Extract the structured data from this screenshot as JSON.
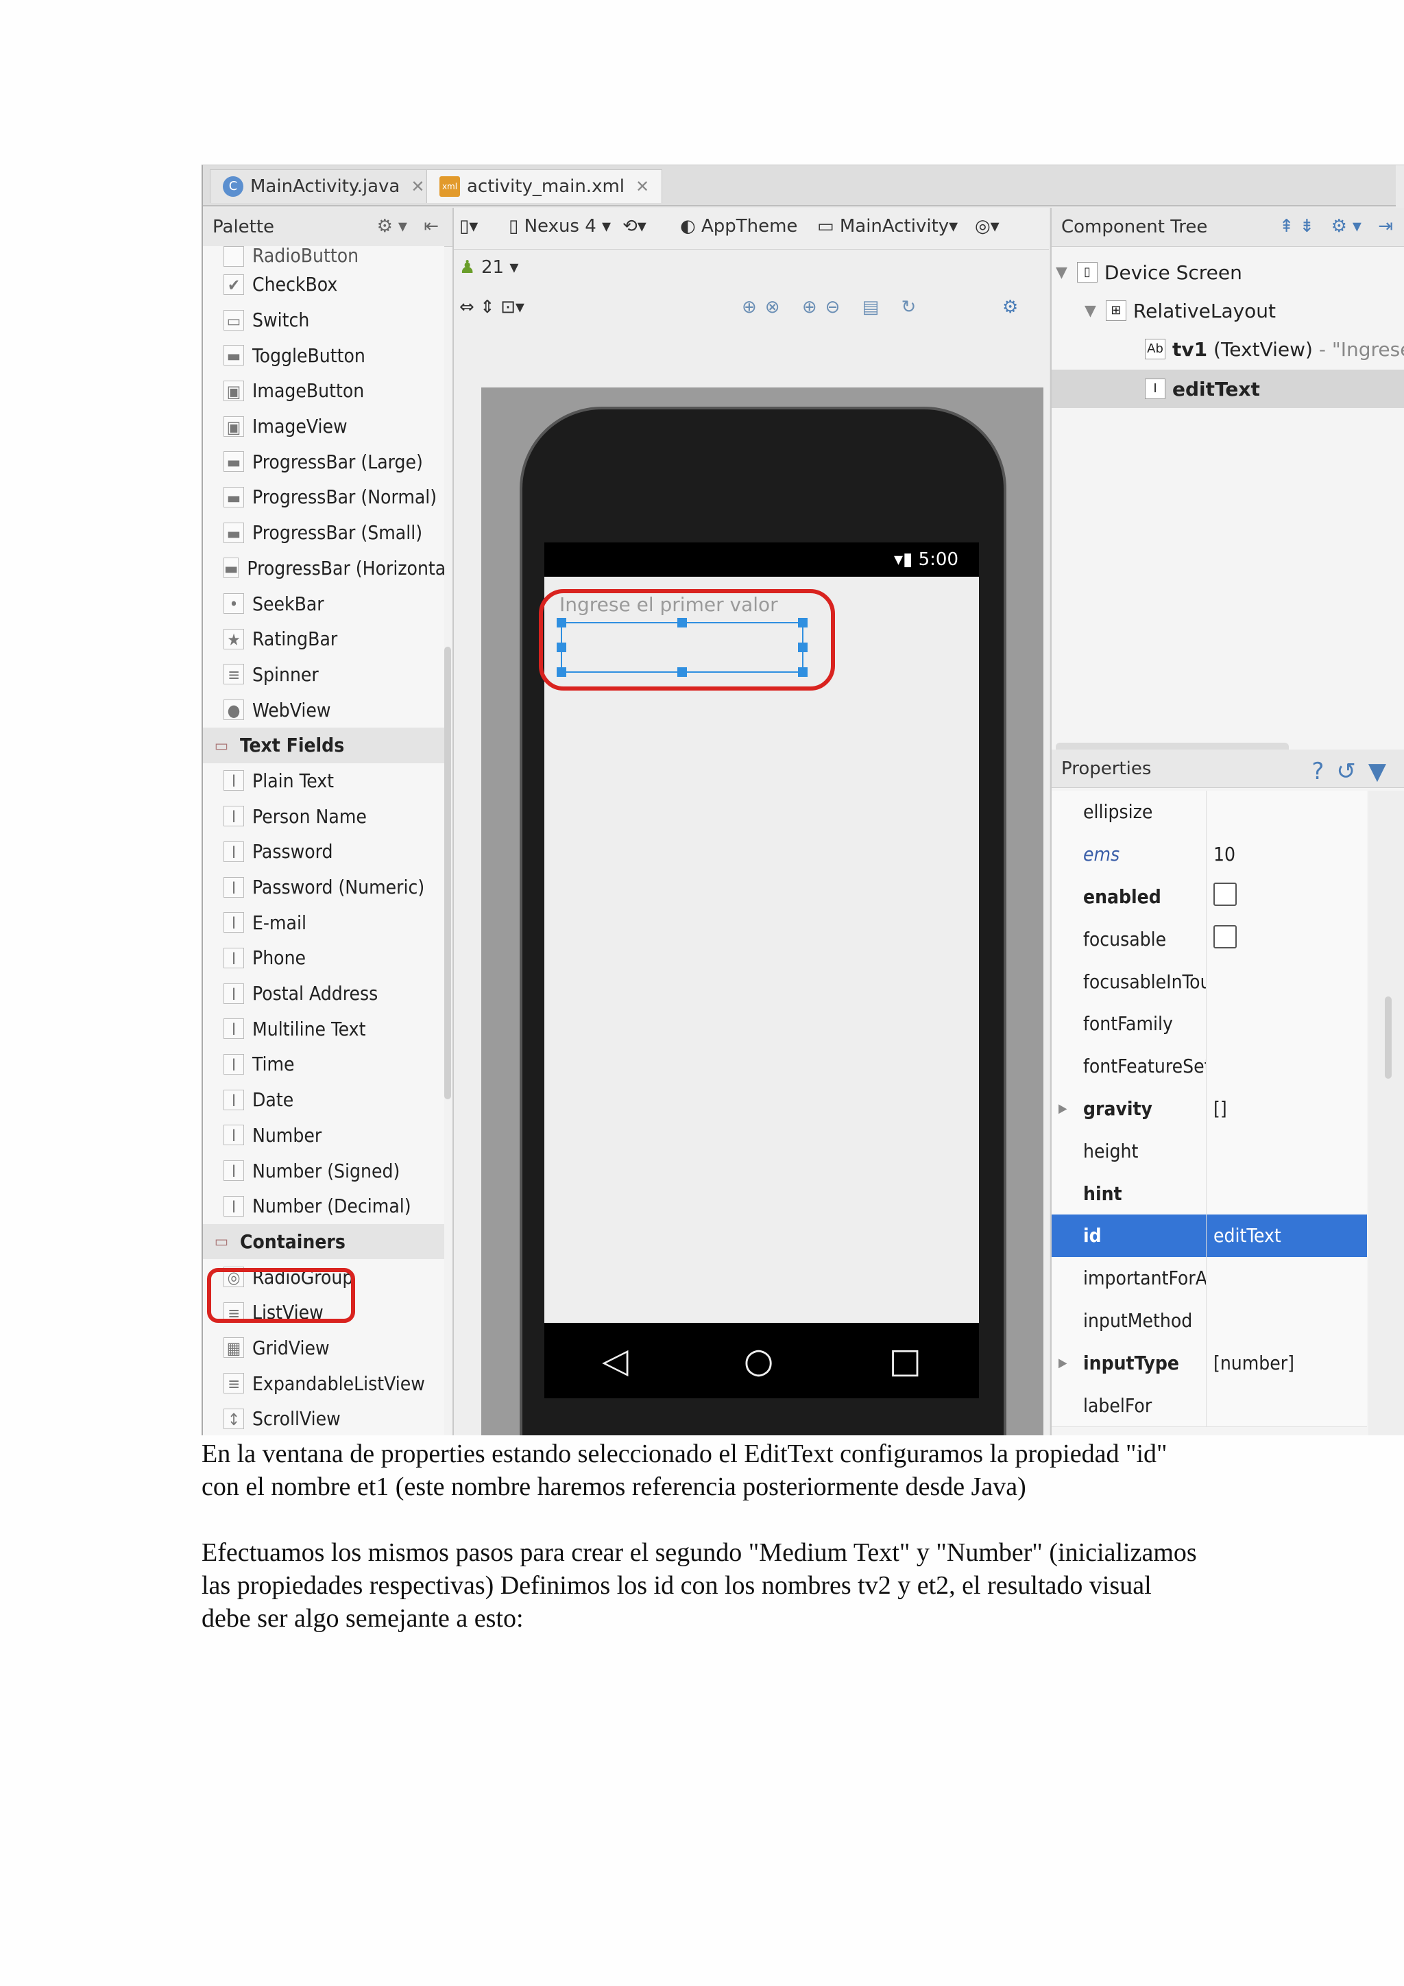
{
  "tabs": [
    {
      "icon": "C",
      "label": "MainActivity.java",
      "active": false
    },
    {
      "icon": "xml",
      "label": "activity_main.xml",
      "active": true
    }
  ],
  "palette": {
    "title": "Palette",
    "items": [
      {
        "label": "RadioButton",
        "cut": true
      },
      {
        "label": "CheckBox",
        "icon": "✔"
      },
      {
        "label": "Switch",
        "icon": "▭"
      },
      {
        "label": "ToggleButton",
        "icon": "▬"
      },
      {
        "label": "ImageButton",
        "icon": "▣"
      },
      {
        "label": "ImageView",
        "icon": "▣"
      },
      {
        "label": "ProgressBar (Large)",
        "icon": "▬"
      },
      {
        "label": "ProgressBar (Normal)",
        "icon": "▬"
      },
      {
        "label": "ProgressBar (Small)",
        "icon": "▬"
      },
      {
        "label": "ProgressBar (Horizontal)",
        "icon": "▬"
      },
      {
        "label": "SeekBar",
        "icon": "•"
      },
      {
        "label": "RatingBar",
        "icon": "★"
      },
      {
        "label": "Spinner",
        "icon": "≡"
      },
      {
        "label": "WebView",
        "icon": "●"
      },
      {
        "label": "Text Fields",
        "category": true
      },
      {
        "label": "Plain Text",
        "icon": "I"
      },
      {
        "label": "Person Name",
        "icon": "I"
      },
      {
        "label": "Password",
        "icon": "I"
      },
      {
        "label": "Password (Numeric)",
        "icon": "I"
      },
      {
        "label": "E-mail",
        "icon": "I"
      },
      {
        "label": "Phone",
        "icon": "I"
      },
      {
        "label": "Postal Address",
        "icon": "I"
      },
      {
        "label": "Multiline Text",
        "icon": "I"
      },
      {
        "label": "Time",
        "icon": "I"
      },
      {
        "label": "Date",
        "icon": "I"
      },
      {
        "label": "Number",
        "icon": "I"
      },
      {
        "label": "Number (Signed)",
        "icon": "I"
      },
      {
        "label": "Number (Decimal)",
        "icon": "I"
      },
      {
        "label": "Containers",
        "category": true
      },
      {
        "label": "RadioGroup",
        "icon": "◎"
      },
      {
        "label": "ListView",
        "icon": "≡"
      },
      {
        "label": "GridView",
        "icon": "▦"
      },
      {
        "label": "ExpandableListView",
        "icon": "≡"
      },
      {
        "label": "ScrollView",
        "icon": "↕"
      }
    ]
  },
  "designer": {
    "device": "Nexus 4",
    "api": "21",
    "theme": "AppTheme",
    "activity": "MainActivity",
    "time": "5:00",
    "hint": "Ingrese el primer valor"
  },
  "component_tree": {
    "title": "Component Tree",
    "device": "Device Screen",
    "layout": "RelativeLayout",
    "tv1_id": "tv1",
    "tv1_type": "(TextView)",
    "tv1_text": "- \"Ingrese",
    "edit": "editText"
  },
  "properties": {
    "title": "Properties",
    "rows": [
      {
        "name": "ellipsize",
        "value": ""
      },
      {
        "name": "ems",
        "value": "10",
        "italic": true
      },
      {
        "name": "enabled",
        "checkbox": true,
        "bold": true
      },
      {
        "name": "focusable",
        "checkbox": true
      },
      {
        "name": "focusableInTouchMode",
        "value": ""
      },
      {
        "name": "fontFamily",
        "value": ""
      },
      {
        "name": "fontFeatureSett",
        "value": ""
      },
      {
        "name": "gravity",
        "value": "[]",
        "bold": true,
        "expand": true
      },
      {
        "name": "height",
        "value": ""
      },
      {
        "name": "hint",
        "value": "",
        "bold": true
      },
      {
        "name": "id",
        "value": "editText",
        "bold": true,
        "selected": true
      },
      {
        "name": "importantForA",
        "value": ""
      },
      {
        "name": "inputMethod",
        "value": ""
      },
      {
        "name": "inputType",
        "value": "[number]",
        "bold": true,
        "expand": true
      },
      {
        "name": "labelFor",
        "value": ""
      }
    ]
  },
  "text": {
    "p1": "En la ventana de properties estando seleccionado el EditText configuramos la propiedad \"id\" con el nombre et1 (este nombre haremos referencia posteriormente desde Java)",
    "p2": "Efectuamos los mismos pasos para crear el segundo \"Medium Text\" y \"Number\" (inicializamos las propiedades respectivas) Definimos los id con los nombres tv2 y et2, el resultado visual debe ser algo semejante a esto:"
  },
  "colors": {
    "highlight": "#d9231f",
    "selection": "#3475d6",
    "handle": "#2f8fe0"
  }
}
